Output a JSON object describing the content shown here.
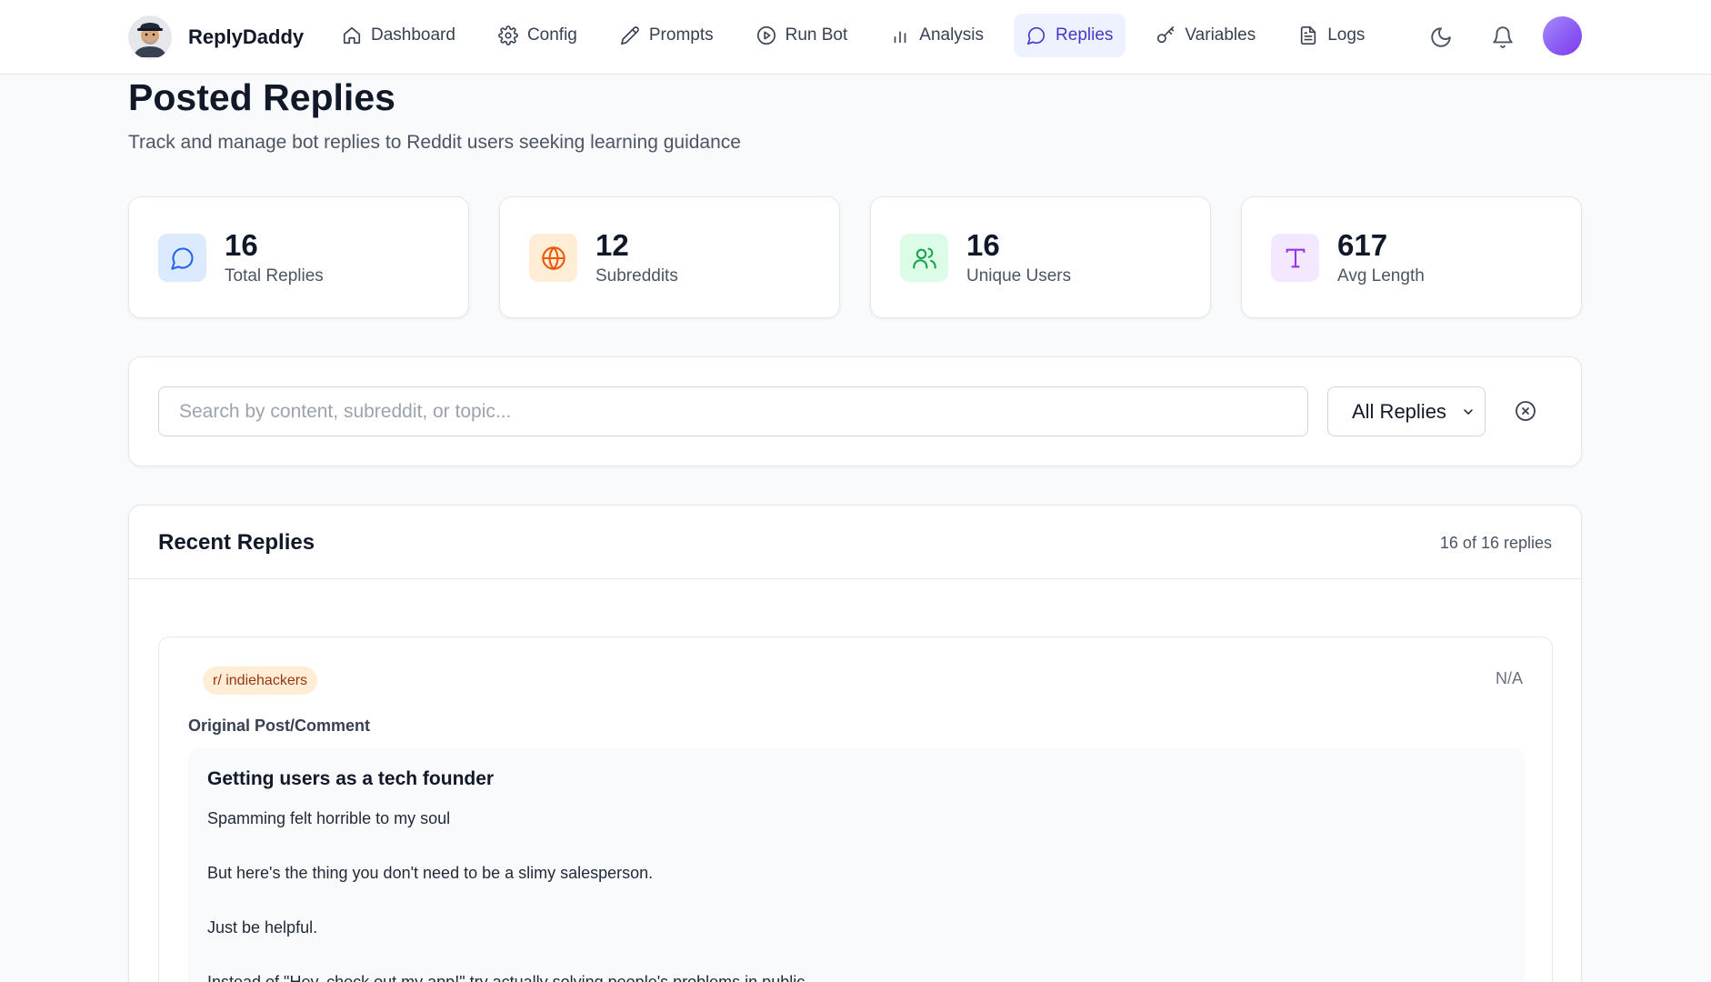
{
  "app": {
    "name": "ReplyDaddy"
  },
  "nav": [
    {
      "label": "Dashboard",
      "icon": "home-icon",
      "active": false
    },
    {
      "label": "Config",
      "icon": "gear-icon",
      "active": false
    },
    {
      "label": "Prompts",
      "icon": "pencil-icon",
      "active": false
    },
    {
      "label": "Run Bot",
      "icon": "play-circle-icon",
      "active": false
    },
    {
      "label": "Analysis",
      "icon": "bar-chart-icon",
      "active": false
    },
    {
      "label": "Replies",
      "icon": "chat-bubble-icon",
      "active": true
    },
    {
      "label": "Variables",
      "icon": "key-icon",
      "active": false
    },
    {
      "label": "Logs",
      "icon": "document-icon",
      "active": false
    }
  ],
  "topbar_icons": [
    "moon-icon",
    "bell-icon",
    "avatar"
  ],
  "header": {
    "title": "Posted Replies",
    "subtitle": "Track and manage bot replies to Reddit users seeking learning guidance"
  },
  "stats": [
    {
      "value": "16",
      "label": "Total Replies",
      "icon": "chat-bubble-icon",
      "bg": "#dbeafe",
      "fg": "#2563eb"
    },
    {
      "value": "12",
      "label": "Subreddits",
      "icon": "globe-icon",
      "bg": "#ffedd5",
      "fg": "#ea580c"
    },
    {
      "value": "16",
      "label": "Unique Users",
      "icon": "users-icon",
      "bg": "#dcfce7",
      "fg": "#16a34a"
    },
    {
      "value": "617",
      "label": "Avg Length",
      "icon": "type-icon",
      "bg": "#f3e8ff",
      "fg": "#9333ea"
    }
  ],
  "filters": {
    "search_value": "",
    "search_placeholder": "Search by content, subreddit, or topic...",
    "select_value": "All Replies"
  },
  "list": {
    "title": "Recent Replies",
    "count_text": "16 of 16 replies",
    "items": [
      {
        "subreddit": "r/ indiehackers",
        "date": "N/A",
        "original_label": "Original Post/Comment",
        "original_title": "Getting users as a tech founder",
        "original_paragraphs": [
          "Spamming felt horrible to my soul",
          "But here's the thing you don't need to be a slimy salesperson.",
          "Just be helpful.",
          "Instead of \"Hey, check out my app!\" try actually solving people's problems in public."
        ]
      }
    ]
  },
  "colors": {
    "accent": "#4338ca",
    "accent_bg": "#eef2ff",
    "badge_bg": "#ffedd5",
    "badge_fg": "#9a3412",
    "page_bg": "#f9fafb"
  }
}
